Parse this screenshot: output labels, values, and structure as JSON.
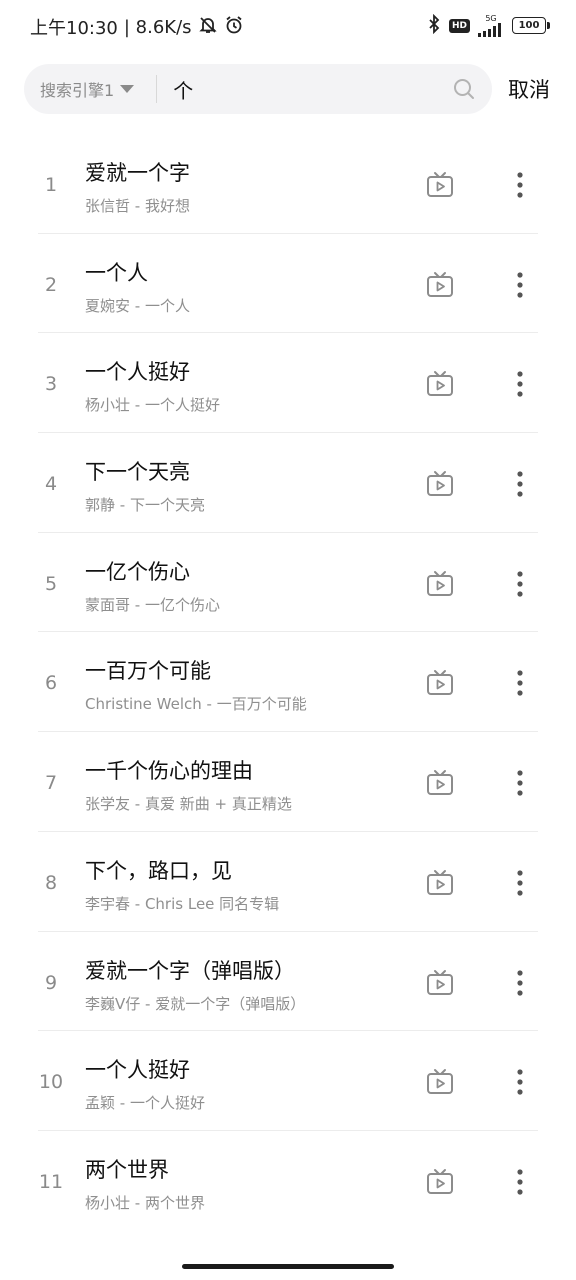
{
  "status_bar": {
    "time": "上午10:30",
    "speed": "| 8.6K/s",
    "icons_left": [
      "mute-bell-icon",
      "alarm-icon"
    ],
    "icons_right": [
      "bluetooth-icon",
      "hd-icon",
      "signal-icon",
      "battery-icon"
    ],
    "hd": "HD",
    "network": "5G",
    "battery": "100"
  },
  "search": {
    "engine": "搜索引擎1",
    "query": "个",
    "cancel": "取消"
  },
  "songs": [
    {
      "index": "1",
      "title": "爱就一个字",
      "subtitle": "张信哲 - 我好想"
    },
    {
      "index": "2",
      "title": "一个人",
      "subtitle": "夏婉安 - 一个人"
    },
    {
      "index": "3",
      "title": "一个人挺好",
      "subtitle": "杨小壮 - 一个人挺好"
    },
    {
      "index": "4",
      "title": "下一个天亮",
      "subtitle": "郭静 - 下一个天亮"
    },
    {
      "index": "5",
      "title": "一亿个伤心",
      "subtitle": "蒙面哥 - 一亿个伤心"
    },
    {
      "index": "6",
      "title": "一百万个可能",
      "subtitle": "Christine Welch - 一百万个可能"
    },
    {
      "index": "7",
      "title": "一千个伤心的理由",
      "subtitle": "张学友 - 真爱 新曲 + 真正精选"
    },
    {
      "index": "8",
      "title": "下个，路口，见",
      "subtitle": "李宇春 - Chris Lee 同名专辑"
    },
    {
      "index": "9",
      "title": "爱就一个字（弹唱版）",
      "subtitle": "李巍V仔 - 爱就一个字（弹唱版）"
    },
    {
      "index": "10",
      "title": "一个人挺好",
      "subtitle": "孟颖 - 一个人挺好"
    },
    {
      "index": "11",
      "title": "两个世界",
      "subtitle": "杨小壮 - 两个世界"
    }
  ]
}
